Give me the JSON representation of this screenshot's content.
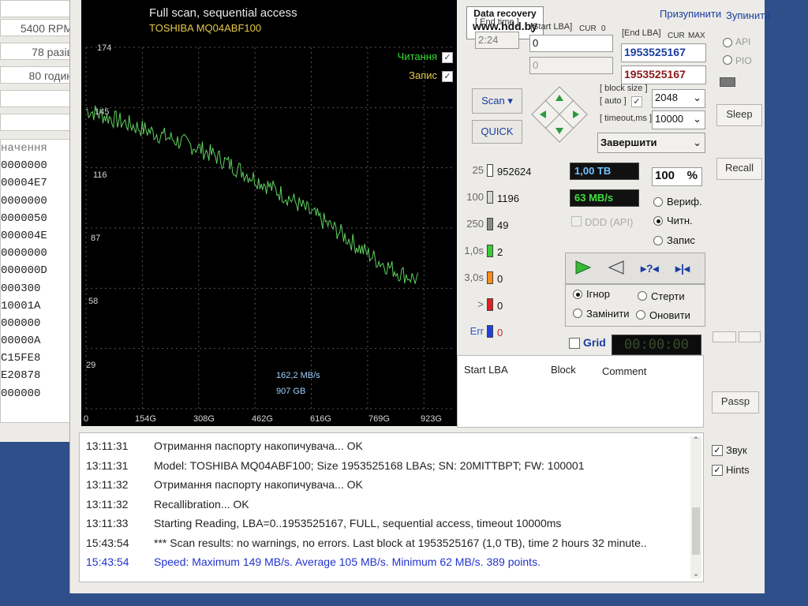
{
  "left_panel": {
    "boxes": [
      "",
      "5400 RPM",
      "78 разів",
      "80 годин",
      "",
      ""
    ],
    "reg_header": "начення",
    "registers": [
      "0000000",
      "00004E7",
      "0000000",
      "0000050",
      "000004E",
      "0000000",
      "000000D",
      "000300",
      "10001A",
      "000000",
      "00000A",
      "C15FE8",
      "E20878",
      "000000"
    ]
  },
  "graph": {
    "title": "Full scan, sequential access",
    "drive": "TOSHIBA MQ04ABF100",
    "brand_line1": "Data recovery",
    "brand_line2": "www.hdd.by",
    "legend_read": "Читання",
    "legend_write": "Запис",
    "yticks": [
      "174",
      "145",
      "116",
      "87",
      "58",
      "29"
    ],
    "xticks": [
      "0",
      "154G",
      "308G",
      "462G",
      "616G",
      "769G",
      "923G"
    ],
    "note_speed": "162,2 MB/s",
    "note_pos": "907 GB"
  },
  "chart_data": {
    "type": "line",
    "title": "Full scan, sequential access",
    "xlabel": "",
    "ylabel": "",
    "xlim": [
      0,
      1000
    ],
    "ylim": [
      0,
      174
    ],
    "grid": true,
    "series": [
      {
        "name": "Читання",
        "x": [
          0,
          50,
          100,
          150,
          200,
          250,
          300,
          350,
          400,
          450,
          500,
          550,
          600,
          650,
          700,
          750,
          800,
          850,
          907,
          960,
          1000
        ],
        "values": [
          144,
          141,
          138,
          135,
          132,
          129,
          126,
          122,
          117,
          112,
          107,
          102,
          96,
          90,
          84,
          77,
          71,
          66,
          62,
          62,
          62
        ]
      }
    ]
  },
  "controls": {
    "end_time_label": "[ End time ]",
    "end_time_value": "2:24",
    "start_lba_label": "[Start LBA]",
    "cur_label": "CUR",
    "zero_label": "0",
    "start_lba_value": "0",
    "start_lba_value2": "0",
    "end_lba_label": "[End LBA]",
    "max_label": "MAX",
    "end_lba_value": "1953525167",
    "end_lba_value2": "1953525167",
    "scan_btn": "Scan",
    "quick_btn": "QUICK",
    "block_size_label": "[ block size ]",
    "auto_label": "[ auto ]",
    "block_size_value": "2048",
    "timeout_label": "[ timeout,ms ]",
    "timeout_value": "10000",
    "action_select": "Завершити"
  },
  "top_menu": {
    "pause": "Призупинити",
    "stop": "Зупинити",
    "api": "API",
    "pio": "PIO",
    "sleep": "Sleep",
    "recall": "Recall",
    "passp": "Passp"
  },
  "stats": [
    {
      "label": "25",
      "count": "952624",
      "color": "#ffffff"
    },
    {
      "label": "100",
      "count": "1196",
      "color": "#d8d8d8"
    },
    {
      "label": "250",
      "count": "49",
      "color": "#8a8a8a"
    },
    {
      "label": "1,0s",
      "count": "2",
      "color": "#33cc33"
    },
    {
      "label": "3,0s",
      "count": "0",
      "color": "#ff8c1a"
    },
    {
      "label": ">",
      "count": "0",
      "color": "#e02020"
    },
    {
      "label": "Err",
      "count": "0",
      "color": "#2040e0"
    }
  ],
  "status": {
    "size": "1,00 TB",
    "percent": "100",
    "percent_sign": "%",
    "speed": "63 MB/s",
    "ddd": "DDD (API)",
    "verify": "Вериф.",
    "read": "Читн.",
    "write": "Запис",
    "ignore": "Ігнор",
    "erase": "Стерти",
    "replace": "Замінити",
    "refresh": "Оновити",
    "grid": "Grid",
    "timer": "00:00:00"
  },
  "table": {
    "col1": "Start LBA",
    "col2": "Block",
    "col3": "Comment"
  },
  "log": [
    {
      "time": "13:11:31",
      "msg": "Отримання паспорту накопичувача... OK",
      "color": "#222222"
    },
    {
      "time": "13:11:31",
      "msg": "Model: TOSHIBA MQ04ABF100; Size 1953525168 LBAs; SN: 20MITTBPT; FW: 100001",
      "color": "#222222"
    },
    {
      "time": "13:11:32",
      "msg": "Отримання паспорту накопичувача... OK",
      "color": "#222222"
    },
    {
      "time": "13:11:32",
      "msg": "Recallibration... OK",
      "color": "#222222"
    },
    {
      "time": "13:11:33",
      "msg": "Starting Reading, LBA=0..1953525167, FULL, sequential access, timeout 10000ms",
      "color": "#222222"
    },
    {
      "time": "15:43:54",
      "msg": "*** Scan results: no warnings, no errors. Last block at 1953525167 (1,0 TB), time 2 hours 32 minute..",
      "color": "#222222"
    },
    {
      "time": "15:43:54",
      "msg": "Speed: Maximum 149 MB/s. Average 105 MB/s. Minimum 62 MB/s. 389 points.",
      "color": "#2233cc"
    }
  ],
  "options": {
    "sound": "Звук",
    "hints": "Hints"
  }
}
